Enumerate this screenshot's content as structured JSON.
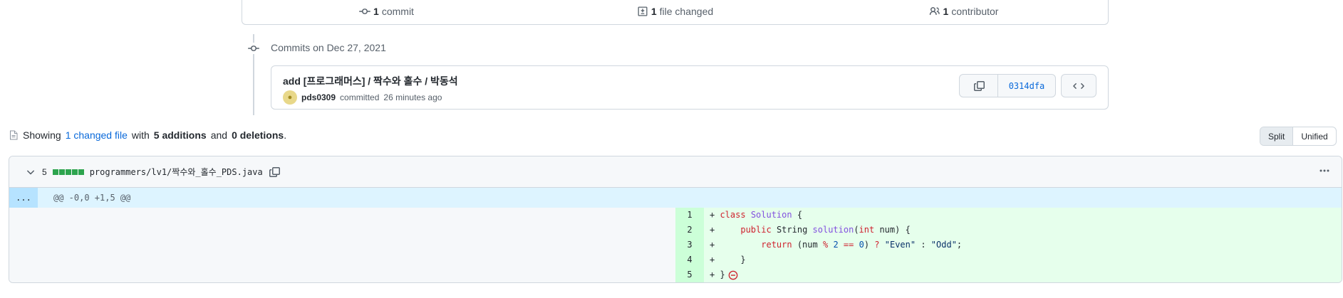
{
  "summary": {
    "commits_count": "1",
    "commits_label": "commit",
    "files_count": "1",
    "files_label": "file changed",
    "contributors_count": "1",
    "contributors_label": "contributor"
  },
  "timeline": {
    "title": "Commits on Dec 27, 2021"
  },
  "commit": {
    "message": "add [프로그래머스] / 짝수와 홀수 / 박동석",
    "author": "pds0309",
    "action": "committed",
    "time": "26 minutes ago",
    "sha": "0314dfa"
  },
  "toc": {
    "showing": "Showing",
    "changed_link": "1 changed file",
    "with": "with",
    "additions": "5 additions",
    "and": "and",
    "deletions": "0 deletions",
    "period": "."
  },
  "view": {
    "split": "Split",
    "unified": "Unified"
  },
  "file": {
    "changes": "5",
    "path": "programmers/lv1/짝수와_홀수_PDS.java",
    "expand_label": "...",
    "hunk_header": "@@ -0,0 +1,5 @@",
    "line_numbers": [
      "1",
      "2",
      "3",
      "4",
      "5"
    ]
  },
  "colors": {
    "accent": "#0969da",
    "addition": "#2da44e",
    "addition_bg": "#e6ffec"
  }
}
